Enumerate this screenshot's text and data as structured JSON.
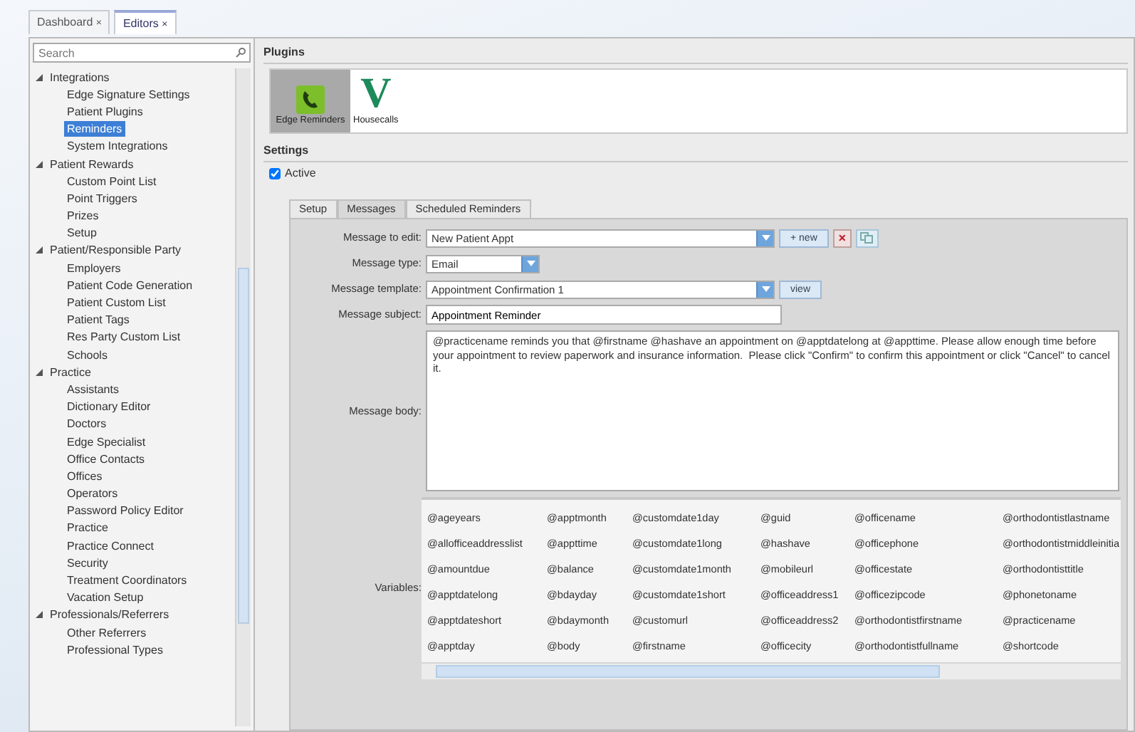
{
  "doc_tabs": [
    {
      "label": "Dashboard",
      "close": "×",
      "selected": false
    },
    {
      "label": "Editors",
      "close": "×",
      "selected": true
    }
  ],
  "search": {
    "placeholder": "Search"
  },
  "tree": [
    {
      "label": "Integrations",
      "expanded": true,
      "children": [
        {
          "label": "Edge Signature Settings",
          "selected": false
        },
        {
          "label": "Patient Plugins",
          "selected": false
        },
        {
          "label": "Reminders",
          "selected": true
        },
        {
          "label": "System Integrations",
          "selected": false
        }
      ]
    },
    {
      "label": "Patient Rewards",
      "expanded": true,
      "children": [
        {
          "label": "Custom Point List",
          "selected": false
        },
        {
          "label": "Point Triggers",
          "selected": false
        },
        {
          "label": "Prizes",
          "selected": false
        },
        {
          "label": "Setup",
          "selected": false
        }
      ]
    },
    {
      "label": "Patient/Responsible Party",
      "expanded": true,
      "children": [
        {
          "label": "Employers",
          "selected": false
        },
        {
          "label": "Patient Code Generation",
          "selected": false
        },
        {
          "label": "Patient Custom List",
          "selected": false
        },
        {
          "label": "Patient Tags",
          "selected": false
        },
        {
          "label": "Res Party Custom List",
          "selected": false
        },
        {
          "label": "Schools",
          "selected": false
        }
      ]
    },
    {
      "label": "Practice",
      "expanded": true,
      "children": [
        {
          "label": "Assistants",
          "selected": false
        },
        {
          "label": "Dictionary Editor",
          "selected": false
        },
        {
          "label": "Doctors",
          "selected": false
        },
        {
          "label": "Edge Specialist",
          "selected": false
        },
        {
          "label": "Office Contacts",
          "selected": false
        },
        {
          "label": "Offices",
          "selected": false
        },
        {
          "label": "Operators",
          "selected": false
        },
        {
          "label": "Password Policy Editor",
          "selected": false
        },
        {
          "label": "Practice",
          "selected": false
        },
        {
          "label": "Practice Connect",
          "selected": false
        },
        {
          "label": "Security",
          "selected": false
        },
        {
          "label": "Treatment Coordinators",
          "selected": false
        },
        {
          "label": "Vacation Setup",
          "selected": false
        }
      ]
    },
    {
      "label": "Professionals/Referrers",
      "expanded": true,
      "children": [
        {
          "label": "Other Referrers",
          "selected": false
        },
        {
          "label": "Professional Types",
          "selected": false
        }
      ]
    }
  ],
  "plugins": {
    "title": "Plugins",
    "items": [
      {
        "label": "Edge Reminders",
        "kind": "phone",
        "selected": true
      },
      {
        "label": "Housecalls",
        "kind": "letter",
        "logo_text": "V",
        "selected": false
      }
    ]
  },
  "settings": {
    "title": "Settings",
    "active": {
      "label": "Active",
      "checked": true
    },
    "tabs": [
      {
        "label": "Setup",
        "selected": false
      },
      {
        "label": "Messages",
        "selected": true
      },
      {
        "label": "Scheduled Reminders",
        "selected": false
      }
    ],
    "form": [
      {
        "kind": "dropdown",
        "label": "Message to edit:",
        "value": "New Patient Appt",
        "buttons": [
          {
            "kind": "text",
            "label": "+ new"
          },
          {
            "kind": "delete",
            "label": "×"
          },
          {
            "kind": "copy"
          }
        ]
      },
      {
        "kind": "short_dropdown",
        "label": "Message type:",
        "value": "Email"
      },
      {
        "kind": "dropdown",
        "label": "Message template:",
        "value": "Appointment Confirmation 1",
        "buttons": [
          {
            "kind": "text",
            "label": "view"
          }
        ]
      },
      {
        "kind": "text",
        "label": "Message subject:",
        "value": "Appointment Reminder"
      },
      {
        "kind": "body",
        "label": "Message body:",
        "value": "@practicename reminds you that @firstname @hashave an appointment on @apptdatelong at @appttime. Please allow enough time before your appointment to review paperwork and insurance information.  Please click \"Confirm\" to confirm this appointment or click \"Cancel\" to cancel it."
      }
    ],
    "variables": {
      "label": "Variables:",
      "columns": [
        [
          "@ageyears",
          "@allofficeaddresslist",
          "@amountdue",
          "@apptdatelong",
          "@apptdateshort",
          "@apptday"
        ],
        [
          "@apptmonth",
          "@appttime",
          "@balance",
          "@bdayday",
          "@bdaymonth",
          "@body"
        ],
        [
          "@customdate1day",
          "@customdate1long",
          "@customdate1month",
          "@customdate1short",
          "@customurl",
          "@firstname"
        ],
        [
          "@guid",
          "@hashave",
          "@mobileurl",
          "@officeaddress1",
          "@officeaddress2",
          "@officecity"
        ],
        [
          "@officename",
          "@officephone",
          "@officestate",
          "@officezipcode",
          "@orthodontistfirstname",
          "@orthodontistfullname"
        ],
        [
          "@orthodontistlastname",
          "@orthodontistmiddleinitia",
          "@orthodontisttitle",
          "@phonetoname",
          "@practicename",
          "@shortcode"
        ]
      ]
    }
  }
}
